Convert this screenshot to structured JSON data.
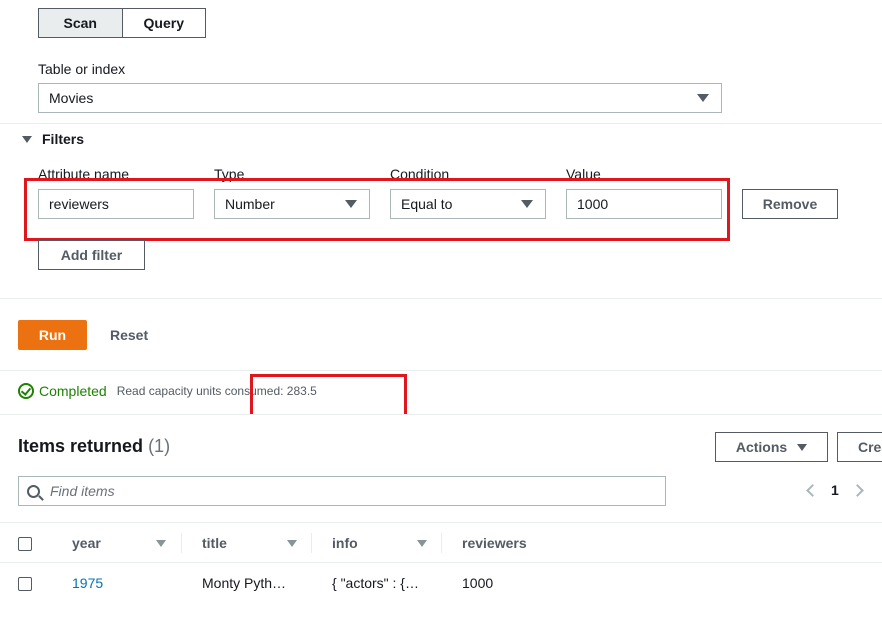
{
  "mode_tabs": [
    {
      "label": "Scan",
      "active": true
    },
    {
      "label": "Query",
      "active": false
    }
  ],
  "table_index": {
    "label": "Table or index",
    "selected": "Movies"
  },
  "filters": {
    "toggle_label": "Filters",
    "columns": {
      "attribute_name": "Attribute name",
      "type": "Type",
      "condition": "Condition",
      "value": "Value"
    },
    "row": {
      "attribute_name": "reviewers",
      "type": "Number",
      "condition": "Equal to",
      "value": "1000",
      "remove_label": "Remove"
    },
    "add_filter_label": "Add filter"
  },
  "actions": {
    "run_label": "Run",
    "reset_label": "Reset"
  },
  "status": {
    "state": "Completed",
    "detail": "Read capacity units consumed: 283.5"
  },
  "results": {
    "title": "Items returned",
    "count": "(1)",
    "actions_label": "Actions",
    "create_label": "Crea",
    "search_placeholder": "Find items",
    "page": "1",
    "columns": [
      "year",
      "title",
      "info",
      "reviewers"
    ],
    "rows": [
      {
        "year": "1975",
        "title": "Monty Pyth…",
        "info": "{ \"actors\" : {…",
        "reviewers": "1000"
      }
    ]
  },
  "colors": {
    "accent": "#ec7211",
    "success": "#1d8102",
    "link": "#0073bb",
    "highlight": "#e0161f"
  }
}
